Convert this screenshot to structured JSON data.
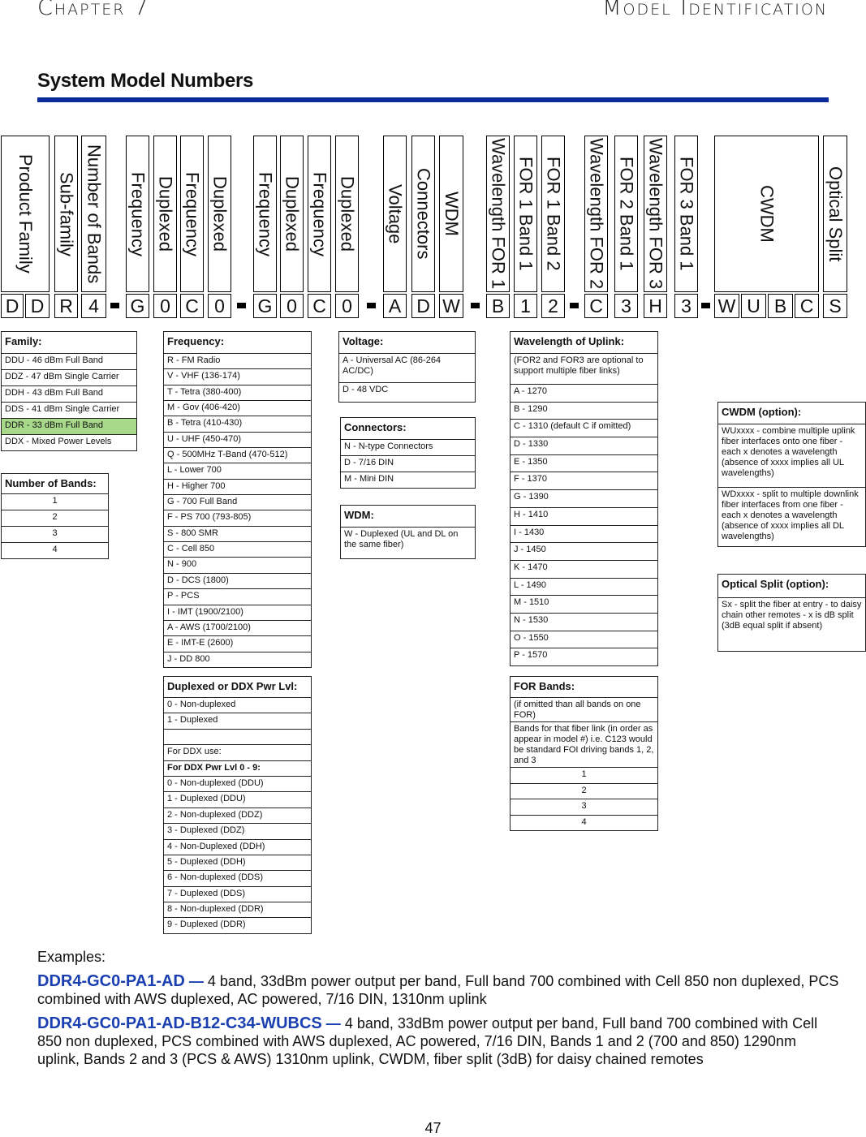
{
  "header": {
    "chapter": "Chapter 7",
    "section": "Model Identification"
  },
  "page_title": "System Model Numbers",
  "accent_color": "#0a2a9a",
  "highlight_color": "#a8d98a",
  "model_diagram": {
    "columns": [
      {
        "label": "Product Family",
        "codes": [
          "D",
          "D"
        ]
      },
      {
        "label": "Sub-family",
        "codes": [
          "R"
        ]
      },
      {
        "label": "Number of Bands",
        "codes": [
          "4"
        ]
      },
      {
        "label": "Frequency",
        "codes": [
          "G"
        ]
      },
      {
        "label": "Duplexed",
        "codes": [
          "0"
        ]
      },
      {
        "label": "Frequency",
        "codes": [
          "C"
        ]
      },
      {
        "label": "Duplexed",
        "codes": [
          "0"
        ]
      },
      {
        "label": "Frequency",
        "codes": [
          "G"
        ]
      },
      {
        "label": "Duplexed",
        "codes": [
          "0"
        ]
      },
      {
        "label": "Frequency",
        "codes": [
          "C"
        ]
      },
      {
        "label": "Duplexed",
        "codes": [
          "0"
        ]
      },
      {
        "label": "Voltage",
        "codes": [
          "A"
        ]
      },
      {
        "label": "Connectors",
        "codes": [
          "D"
        ]
      },
      {
        "label": "WDM",
        "codes": [
          "W"
        ]
      },
      {
        "label": "Wavelength FOR 1",
        "codes": [
          "B"
        ]
      },
      {
        "label": "FOR 1 Band 1",
        "codes": [
          "1"
        ]
      },
      {
        "label": "FOR 1 Band 2",
        "codes": [
          "2"
        ]
      },
      {
        "label": "Wavelength FOR 2",
        "codes": [
          "C"
        ]
      },
      {
        "label": "FOR 2 Band 1",
        "codes": [
          "3"
        ]
      },
      {
        "label": "Wavelength FOR 3",
        "codes": [
          "H"
        ]
      },
      {
        "label": "FOR 3 Band 1",
        "codes": [
          "3"
        ]
      },
      {
        "label": "CWDM",
        "codes": [
          "W",
          "U",
          "B",
          "C"
        ]
      },
      {
        "label": "Optical Split",
        "codes": [
          "S"
        ]
      }
    ]
  },
  "tables": {
    "family": {
      "title": "Family:",
      "rows": [
        "DDU - 46 dBm Full Band",
        "DDZ - 47 dBm Single Carrier",
        "DDH - 43 dBm Full Band",
        "DDS - 41 dBm Single Carrier",
        "DDR - 33 dBm Full Band",
        "DDX - Mixed Power Levels"
      ],
      "highlighted_row": "DDR - 33 dBm Full Band"
    },
    "bands": {
      "title": "Number of Bands:",
      "rows": [
        "1",
        "2",
        "3",
        "4"
      ]
    },
    "frequency": {
      "title": "Frequency:",
      "rows": [
        "R - FM Radio",
        "V - VHF (136-174)",
        "T - Tetra (380-400)",
        "M - Gov (406-420)",
        "B - Tetra (410-430)",
        "U - UHF (450-470)",
        "Q - 500MHz T-Band (470-512)",
        "L - Lower 700",
        "H - Higher 700",
        "G - 700 Full Band",
        "F - PS 700 (793-805)",
        "S - 800 SMR",
        "C - Cell 850",
        "N - 900",
        "D - DCS (1800)",
        "P - PCS",
        "I - IMT (1900/2100)",
        "A - AWS (1700/2100)",
        "E - IMT-E (2600)",
        "J - DD 800"
      ]
    },
    "duplexed": {
      "title": "Duplexed or DDX Pwr Lvl:",
      "rows": [
        "0 - Non-duplexed",
        "1 - Duplexed",
        "",
        "For DDX use:",
        "For DDX Pwr Lvl 0 - 9:",
        "0 - Non-duplexed (DDU)",
        "1 - Duplexed (DDU)",
        "2 - Non-duplexed (DDZ)",
        "3 - Duplexed (DDZ)",
        "4 - Non-Duplexed (DDH)",
        "5 - Duplexed (DDH)",
        "6 - Non-duplexed (DDS)",
        "7 - Duplexed (DDS)",
        "8 - Non-duplexed (DDR)",
        "9 - Duplexed (DDR)"
      ]
    },
    "voltage": {
      "title": "Voltage:",
      "rows": [
        "A - Universal AC (86-264 AC/DC)",
        "D - 48 VDC"
      ]
    },
    "connectors": {
      "title": "Connectors:",
      "rows": [
        "N - N-type Connectors",
        "D - 7/16 DIN",
        "M - Mini DIN"
      ]
    },
    "wdm": {
      "title": "WDM:",
      "rows": [
        "W - Duplexed (UL and DL on the same fiber)"
      ]
    },
    "wavelength": {
      "title": "Wavelength of Uplink:",
      "rows": [
        "(FOR2 and FOR3 are optional to support multiple fiber links)",
        "A - 1270",
        "B - 1290",
        "C - 1310 (default C if omitted)",
        "D - 1330",
        "E - 1350",
        "F - 1370",
        "G - 1390",
        "H - 1410",
        "I - 1430",
        "J - 1450",
        "K - 1470",
        "L - 1490",
        "M - 1510",
        "N - 1530",
        "O - 1550",
        "P - 1570"
      ]
    },
    "for_bands": {
      "title": "FOR Bands:",
      "rows": [
        "(if omitted than all bands on one FOR)",
        "Bands for that fiber link (in order as appear in model #) i.e. C123 would be standard FOI driving bands 1, 2, and 3",
        "1",
        "2",
        "3",
        "4"
      ]
    },
    "cwdm": {
      "title": "CWDM (option):",
      "rows": [
        "WUxxxx - combine multiple uplink fiber interfaces onto one fiber - each x denotes a wavelength (absence of xxxx implies all UL wavelengths)",
        "WDxxxx - split to multiple downlink fiber interfaces from one fiber - each x denotes a wavelength (absence of xxxx implies all DL wavelengths)"
      ]
    },
    "optical_split": {
      "title": "Optical Split (option):",
      "rows": [
        "Sx - split the fiber at entry - to daisy chain other remotes - x is dB split (3dB equal split if absent)"
      ]
    }
  },
  "examples": {
    "heading": "Examples:",
    "items": [
      {
        "model": "DDR4-GC0-PA1-AD",
        "separator": "—",
        "description": "4 band, 33dBm power output per band, Full band 700 combined with Cell 850 non duplexed, PCS combined with AWS duplexed, AC powered, 7/16 DIN, 1310nm uplink"
      },
      {
        "model": "DDR4-GC0-PA1-AD-B12-C34-WUBCS",
        "separator": "—",
        "description": "4 band, 33dBm power output per band, Full band 700 combined with Cell 850 non duplexed, PCS combined with AWS duplexed, AC powered, 7/16 DIN, Bands 1 and 2 (700 and 850) 1290nm uplink, Bands 2 and 3 (PCS & AWS) 1310nm uplink, CWDM, fiber split (3dB) for daisy chained remotes"
      }
    ]
  },
  "page_number": "47"
}
